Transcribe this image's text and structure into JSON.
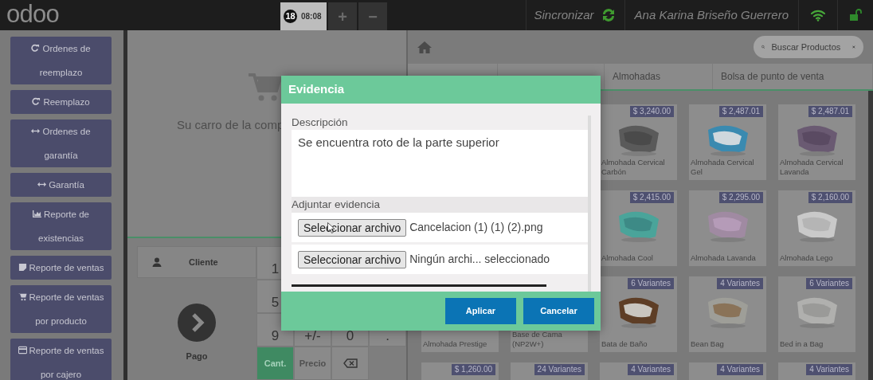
{
  "header": {
    "logo": "odoo",
    "order": {
      "number": "18",
      "time": "08:08",
      "selected": true
    },
    "order_buttons": [
      "+",
      "−"
    ],
    "sync_label": "Sincronizar",
    "user": "Ana Karina Briseño Guerrero"
  },
  "sidebar": {
    "items": [
      {
        "label": "Ordenes de reemplazo"
      },
      {
        "label": "Reemplazo"
      },
      {
        "label": "Ordenes de garantía"
      },
      {
        "label": "Garantía"
      },
      {
        "label": "Reporte de existencias"
      },
      {
        "label": "Reporte de ventas"
      },
      {
        "label": "Reporte de ventas por producto"
      },
      {
        "label": "Reporte de ventas por cajero"
      }
    ]
  },
  "cart": {
    "empty_message": "Su carro de la comp"
  },
  "customer_button": "Cliente",
  "payment_button": "Pago",
  "numpad": {
    "rows": [
      [
        {
          "kind": "key",
          "label": "1"
        }
      ],
      [
        {
          "kind": "key",
          "label": "5"
        }
      ],
      [
        {
          "kind": "key",
          "label": "9"
        },
        {
          "kind": "key",
          "label": "+/-"
        },
        {
          "kind": "key",
          "label": "0"
        },
        {
          "kind": "key",
          "label": "."
        }
      ],
      [
        {
          "kind": "mode",
          "label": "Cant.",
          "selected": true
        },
        {
          "kind": "mode",
          "label": "Precio",
          "selected": false
        },
        {
          "kind": "backspace"
        }
      ]
    ]
  },
  "products": {
    "search_placeholder": "Buscar Productos",
    "categories": [
      "Almohadas",
      "Bolsa de punto de venta"
    ],
    "rows": [
      [
        {
          "badge": "$ 3,240.00",
          "name": "Almohada Cervical Carbón",
          "kind": "picture"
        },
        {
          "badge": "$ 2,487.01",
          "name": "Almohada Cervical Gel",
          "kind": "picture"
        },
        {
          "badge": "$ 2,487.01",
          "name": "Almohada Cervical Lavanda",
          "kind": "picture"
        }
      ],
      [
        {
          "badge": "$ 2,415.00",
          "name": "Almohada Cool",
          "kind": "picture"
        },
        {
          "badge": "$ 2,295.00",
          "name": "Almohada Lavanda",
          "kind": "picture"
        },
        {
          "badge": "$ 2,160.00",
          "name": "Almohada Lego",
          "kind": "picture"
        }
      ],
      [
        {
          "name": "Almohada Prestige"
        },
        {
          "name": "Base de Cama (NP2W+)"
        },
        {
          "badge": "6 Variantes",
          "name": "Bata de Baño",
          "kind": "picture"
        },
        {
          "badge": "4 Variantes",
          "name": "Bean Bag",
          "kind": "picture"
        },
        {
          "badge": "6 Variantes",
          "name": "Bed in a Bag",
          "kind": "picture"
        }
      ],
      [
        {
          "badge": "$ 1,260.00"
        },
        {
          "badge": "24 Variantes"
        },
        {
          "badge": "4 Variantes"
        },
        {
          "badge": "4 Variantes"
        },
        {
          "badge": "4 Variantes"
        }
      ]
    ]
  },
  "dialog": {
    "title": "Evidencia",
    "description_label": "Descripción",
    "description": "Se encuentra roto de la parte superior",
    "attach_label": "Adjuntar evidencia",
    "files": [
      {
        "button": "Seleccionar archivo",
        "file": "Cancelacion (1) (1) (2).png"
      },
      {
        "button": "Seleccionar archivo",
        "file": "Ningún archi... seleccionado"
      }
    ],
    "buttons": [
      "Aplicar",
      "Cancelar"
    ]
  }
}
